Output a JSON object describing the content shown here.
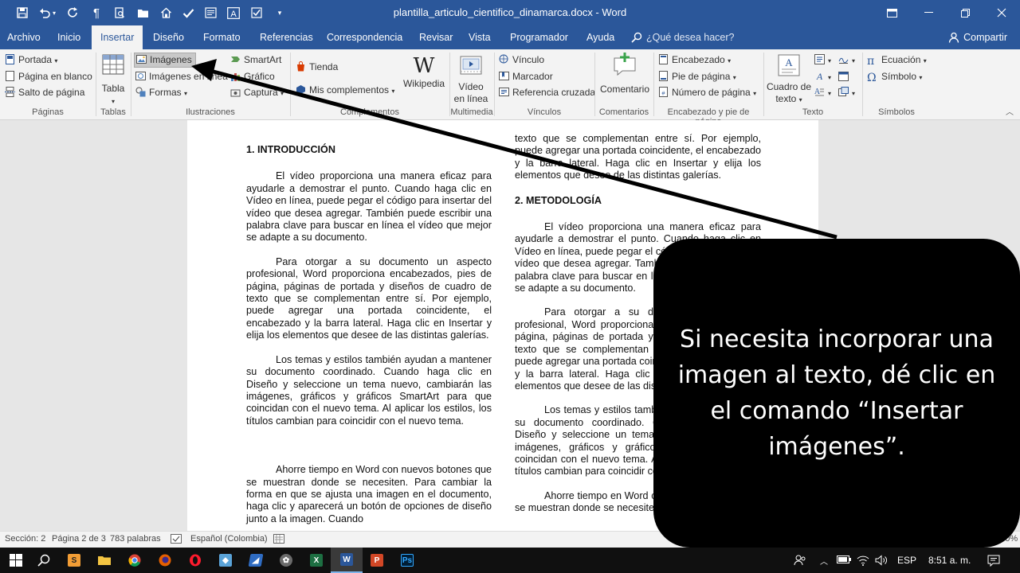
{
  "window": {
    "title": "plantilla_articulo_cientifico_dinamarca.docx  -  Word",
    "quick_access": [
      "save-icon",
      "undo-icon",
      "redo-icon",
      "paragraph-marks-icon",
      "print-preview-icon",
      "open-folder-icon",
      "home-icon",
      "check-icon",
      "form-icon",
      "text-box-icon",
      "checkbox-icon",
      "customize-toolbar-icon"
    ]
  },
  "tabs": [
    "Archivo",
    "Inicio",
    "Insertar",
    "Diseño",
    "Formato",
    "Referencias",
    "Correspondencia",
    "Revisar",
    "Vista",
    "Programador",
    "Ayuda"
  ],
  "active_tab": "Insertar",
  "tell_me": "¿Qué desea hacer?",
  "share": "Compartir",
  "ribbon": {
    "paginas": {
      "label": "Páginas",
      "portada": "Portada",
      "pagina_en_blanco": "Página en blanco",
      "salto_de_pagina": "Salto de página"
    },
    "tablas": {
      "label": "Tablas",
      "tabla": "Tabla"
    },
    "ilustraciones": {
      "label": "Ilustraciones",
      "imagenes": "Imágenes",
      "imagenes_en_linea": "Imágenes en línea",
      "formas": "Formas",
      "smartart": "SmartArt",
      "grafico": "Gráfico",
      "captura": "Captura"
    },
    "complementos": {
      "label": "Complementos",
      "tienda": "Tienda",
      "mis_complementos": "Mis complementos",
      "wikipedia": "Wikipedia"
    },
    "multimedia": {
      "label": "Multimedia",
      "video_1": "Vídeo",
      "video_2": "en línea"
    },
    "vinculos": {
      "label": "Vínculos",
      "vinculo": "Vínculo",
      "marcador": "Marcador",
      "referencia_cruzada": "Referencia cruzada"
    },
    "comentarios": {
      "label": "Comentarios",
      "comentario": "Comentario"
    },
    "encabezado_pie": {
      "label": "Encabezado y pie de página",
      "encabezado": "Encabezado",
      "pie_de_pagina": "Pie de página",
      "numero_de_pagina": "Número de página"
    },
    "texto": {
      "label": "Texto",
      "cuadro_1": "Cuadro de",
      "cuadro_2": "texto"
    },
    "simbolos": {
      "label": "Símbolos",
      "ecuacion": "Ecuación",
      "simbolo": "Símbolo"
    }
  },
  "document": {
    "left_column": {
      "heading": "1.   INTRODUCCIÓN",
      "p1": "El vídeo proporciona una manera eficaz para ayudarle a demostrar el punto. Cuando haga clic en Vídeo en línea, puede pegar el código para insertar del vídeo que desea agregar. También puede escribir una palabra clave para buscar en línea el vídeo que mejor se adapte a su documento.",
      "p2": "Para otorgar a su documento un aspecto profesional, Word proporciona encabezados, pies de página, páginas de portada y diseños de cuadro de texto que se complementan entre sí. Por ejemplo, puede agregar una portada coincidente, el encabezado y la barra lateral. Haga clic en Insertar y elija los elementos que desee de las distintas galerías.",
      "p3": "Los temas y estilos también ayudan a mantener su documento coordinado. Cuando haga clic en Diseño y seleccione un tema nuevo, cambiarán las imágenes, gráficos y gráficos SmartArt para que coincidan con el nuevo tema. Al aplicar los estilos, los títulos cambian para coincidir con el nuevo tema.",
      "p4": "Ahorre tiempo en Word con nuevos botones que se muestran donde se necesiten. Para cambiar la forma en que se ajusta una imagen en el documento, haga clic y aparecerá un botón de opciones de diseño junto a la imagen. Cuando"
    },
    "right_column": {
      "p0": "texto que se complementan entre sí. Por ejemplo, puede agregar una portada coincidente, el encabezado y la barra lateral. Haga clic en Insertar y elija los elementos que desee de las distintas galerías.",
      "heading": "2.   METODOLOGÍA",
      "p1": "El vídeo proporciona una manera eficaz para ayudarle a demostrar el punto. Cuando haga clic en Vídeo en línea, puede pegar el código para insertar del vídeo que desea agregar. También puede escribir una palabra clave para buscar en línea el vídeo que mejor se adapte a su documento.",
      "p2": "Para otorgar a su documento un aspecto profesional, Word proporciona encabezados, pies de página, páginas de portada y diseños de cuadro de texto que se complementan entre sí. Por ejemplo, puede agregar una portada coincidente, el encabezado y la barra lateral. Haga clic en Insertar y elija los elementos que desee de las distintas galerías.",
      "p3": "Los temas y estilos también ayudan a mantener su documento coordinado. Cuando haga clic en Diseño y seleccione un tema nuevo, cambiarán las imágenes, gráficos y gráficos SmartArt para que coincidan con el nuevo tema. Al aplicar los estilos, los títulos cambian para coincidir con el nuevo tema.",
      "p4": "Ahorre tiempo en Word con nuevos botones que se muestran donde se necesiten."
    }
  },
  "callout": {
    "text": "Si necesita incorporar una imagen al texto, dé clic en el comando “Insertar imágenes”."
  },
  "status": {
    "section": "Sección: 2",
    "page": "Página 2 de 3",
    "words": "783 palabras",
    "language": "Español (Colombia)",
    "zoom": "100%"
  },
  "taskbar": {
    "language": "ESP",
    "time": "8:51 a. m."
  },
  "colors": {
    "word_blue": "#2b579a",
    "ribbon_bg": "#f3f3f3",
    "callout_bg": "#000000"
  }
}
